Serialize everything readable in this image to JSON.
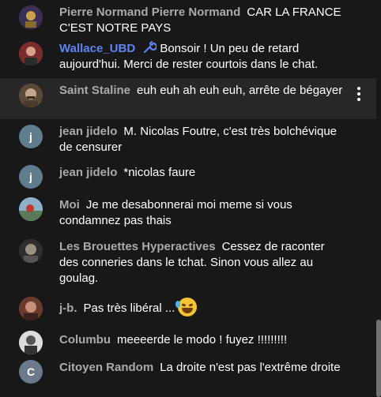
{
  "messages": [
    {
      "author": "Pierre Normand Pierre Normand",
      "text": "CAR LA FRANCE C'EST NOTRE PAYS",
      "avatar_color": "#5a4a6a"
    },
    {
      "author": "Wallace_UBD",
      "text": "Bonsoir ! Un peu de retard aujourd'hui. Merci de rester courtois dans le chat.",
      "avatar_color": "#8b3a3a",
      "role": "moderator",
      "role_icon": "wrench-icon",
      "mod_color": "#5e84f1"
    },
    {
      "author": "Saint Staline",
      "text": "euh euh ah euh euh, arrête de bégayer",
      "avatar_color": "#6b5a4a",
      "highlighted": true
    },
    {
      "author": "jean jidelo",
      "text": "M. Nicolas Foutre, c'est très bolchévique de censurer",
      "avatar_letter": "j",
      "avatar_color": "#5f7d8d"
    },
    {
      "author": "jean jidelo",
      "text": "*nicolas faure",
      "avatar_letter": "j",
      "avatar_color": "#5f7d8d"
    },
    {
      "author": "Moi",
      "text": "Je me desabonnerai moi meme si vous condamnez pas thais",
      "avatar_color": "#6a8aa0"
    },
    {
      "author": "Les Brouettes Hyperactives",
      "text": "Cessez de raconter des conneries dans le tchat. Sinon vous allez au goulag.",
      "avatar_color": "#3a3a3a"
    },
    {
      "author": "j-b.",
      "text": "Pas très libéral ...",
      "avatar_color": "#7a4a3a",
      "emoji": "rolling-on-floor-laughing-emoji"
    },
    {
      "author": "Columbu",
      "text": "meeeerde le modo ! fuyez !!!!!!!!!",
      "avatar_color": "#9a9a9a"
    },
    {
      "author": "Citoyen Random",
      "text": "La droite n'est pas l'extrême droite",
      "avatar_letter": "C",
      "avatar_color": "#6a7a8a"
    }
  ],
  "icons": {
    "more": "more-vert-icon"
  }
}
